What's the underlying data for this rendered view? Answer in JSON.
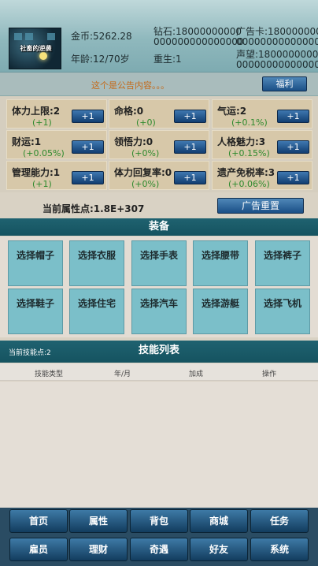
{
  "header": {
    "avatar_title": "社畜的逆袭",
    "gold": "金币:5262.28",
    "age": "年龄:12/70岁",
    "diamond_line1": "钻石:18000000000",
    "diamond_line2": "000000000000000",
    "rebirth": "重生:1",
    "adcard_line1": "广告卡:180000000",
    "adcard_line2": "000000000000000",
    "fame_line1": "声望:18000000000",
    "fame_line2": "000000000000000"
  },
  "notice": {
    "text": "这个是公告内容。。。",
    "welfare_label": "福利"
  },
  "attributes": [
    {
      "name": "体力上限:2",
      "bonus": "(+1)",
      "button": "+1"
    },
    {
      "name": "命格:0",
      "bonus": "(+0)",
      "button": "+1"
    },
    {
      "name": "气运:2",
      "bonus": "(+0.1%)",
      "button": "+1"
    },
    {
      "name": "财运:1",
      "bonus": "(+0.05%)",
      "button": "+1"
    },
    {
      "name": "领悟力:0",
      "bonus": "(+0%)",
      "button": "+1"
    },
    {
      "name": "人格魅力:3",
      "bonus": "(+0.15%)",
      "button": "+1"
    },
    {
      "name": "管理能力:1",
      "bonus": "(+1)",
      "button": "+1"
    },
    {
      "name": "体力回复率:0",
      "bonus": "(+0%)",
      "button": "+1"
    },
    {
      "name": "遗产免税率:3",
      "bonus": "(+0.06%)",
      "button": "+1"
    }
  ],
  "attr_points": "当前属性点:1.8E+307",
  "ad_reset_label": "广告重置",
  "equipment": {
    "title": "装备",
    "slots": [
      "选择帽子",
      "选择衣服",
      "选择手表",
      "选择腰带",
      "选择裤子",
      "选择鞋子",
      "选择住宅",
      "选择汽车",
      "选择游艇",
      "选择飞机"
    ]
  },
  "skills": {
    "title": "技能列表",
    "points": "当前技能点:2",
    "columns": [
      "技能类型",
      "年/月",
      "加成",
      "操作"
    ]
  },
  "nav": [
    "首页",
    "属性",
    "背包",
    "商城",
    "任务",
    "雇员",
    "理财",
    "奇遇",
    "好友",
    "系统"
  ]
}
